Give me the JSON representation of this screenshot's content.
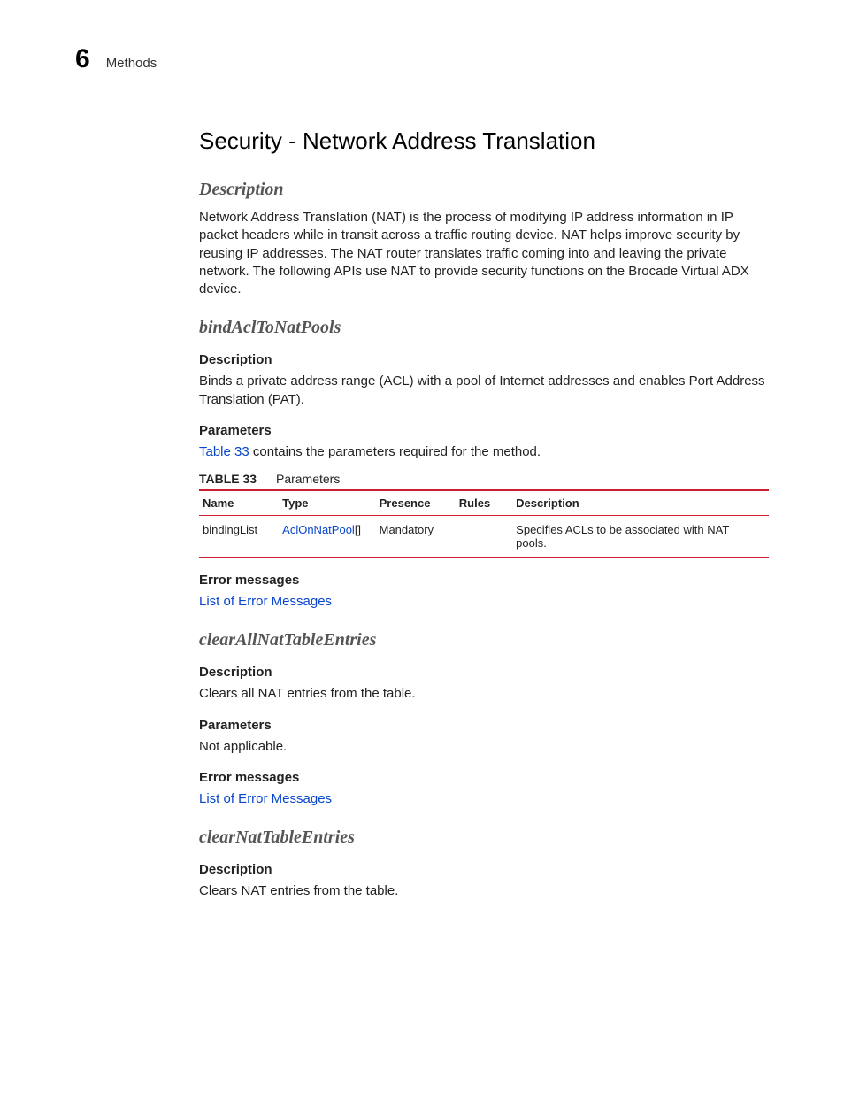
{
  "header": {
    "chapter_number": "6",
    "chapter_label": "Methods"
  },
  "main": {
    "title": "Security - Network Address Translation",
    "description_heading": "Description",
    "description_body": "Network Address Translation (NAT) is the process of modifying IP address information in IP packet headers while in transit across a traffic routing device. NAT helps improve security by reusing IP addresses. The NAT router translates traffic coming into and leaving the private network. The following APIs use NAT to provide security functions on the Brocade Virtual ADX device."
  },
  "methods": {
    "bindAclToNatPools": {
      "heading": "bindAclToNatPools",
      "desc_label": "Description",
      "desc_text": "Binds a private address range (ACL) with a pool of Internet addresses and enables Port Address Translation (PAT).",
      "params_label": "Parameters",
      "params_intro_link": "Table 33",
      "params_intro_rest": " contains the parameters required for the method.",
      "table_label": "TABLE 33",
      "table_caption": "Parameters",
      "table_headers": {
        "name": "Name",
        "type": "Type",
        "presence": "Presence",
        "rules": "Rules",
        "description": "Description"
      },
      "table_rows": [
        {
          "name": "bindingList",
          "type_link": "AclOnNatPool",
          "type_suffix": "[]",
          "presence": "Mandatory",
          "rules": "",
          "description": "Specifies ACLs to be associated with NAT pools."
        }
      ],
      "err_label": "Error messages",
      "err_link": "List of Error Messages"
    },
    "clearAllNatTableEntries": {
      "heading": "clearAllNatTableEntries",
      "desc_label": "Description",
      "desc_text": "Clears all NAT entries from the table.",
      "params_label": "Parameters",
      "params_text": "Not applicable.",
      "err_label": "Error messages",
      "err_link": "List of Error Messages"
    },
    "clearNatTableEntries": {
      "heading": "clearNatTableEntries",
      "desc_label": "Description",
      "desc_text": "Clears NAT entries from the table."
    }
  }
}
